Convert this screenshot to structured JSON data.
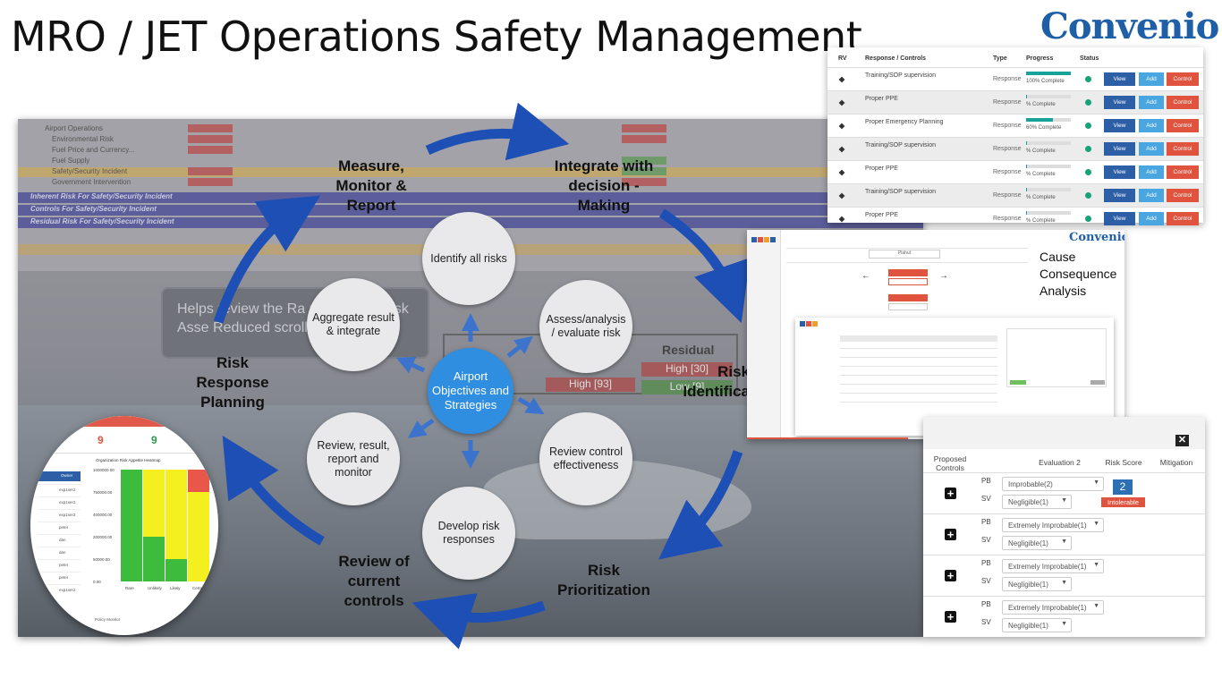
{
  "title": "MRO / JET Operations Safety Management",
  "logo": "Convenio",
  "background": {
    "rows": [
      "Airport Operations",
      "Environmental Risk",
      "Fuel Price and Currency...",
      "Fuel Supply",
      "Safety/Security Incident",
      "Government Intervention"
    ],
    "bands": [
      "Inherent Risk For Safety/Security Incident",
      "Controls For Safety/Security Incident",
      "Residual Risk For Safety/Security Incident"
    ],
    "help_text": "Helps review the Ra respond to Risk Asse Reduced scrolling.",
    "residual_label": "Residual",
    "high_a": "High [93]",
    "high_b": "High [30]",
    "low_b": "Low [9]"
  },
  "cycle": {
    "center": "Airport Objectives and Strategies",
    "circles": [
      "Identify all risks",
      "Assess/analysis / evaluate risk",
      "Review control effectiveness",
      "Develop risk responses",
      "Review, result, report and monitor",
      "Aggregate result & integrate"
    ],
    "steps": [
      "Measure, Monitor & Report",
      "Integrate with decision - Making",
      "Risk Identifica",
      "Risk Prioritization",
      "Review of current controls",
      "Risk Response Planning"
    ]
  },
  "response_table": {
    "headers": [
      "RV",
      "Response / Controls",
      "Type",
      "Progress",
      "Status"
    ],
    "rows": [
      {
        "name": "Training/SOP supervision",
        "type": "Response",
        "pct": "100% Complete",
        "fill": 1.0
      },
      {
        "name": "Proper PPE",
        "type": "Response",
        "pct": "% Complete",
        "fill": 0.02
      },
      {
        "name": "Proper Emergency Planning",
        "type": "Response",
        "pct": "60% Complete",
        "fill": 0.6
      },
      {
        "name": "Training/SOP supervision",
        "type": "Response",
        "pct": "% Complete",
        "fill": 0.02
      },
      {
        "name": "Proper PPE",
        "type": "Response",
        "pct": "% Complete",
        "fill": 0.02
      },
      {
        "name": "Training/SOP supervision",
        "type": "Response",
        "pct": "% Complete",
        "fill": 0.02
      },
      {
        "name": "Proper PPE",
        "type": "Response",
        "pct": "% Complete",
        "fill": 0.02
      }
    ],
    "btn_view": "View",
    "btn_add": "Add",
    "btn_control": "Control"
  },
  "cause_panel": {
    "logo": "Convenio",
    "caption": [
      "Cause",
      "Consequence",
      "Analysis"
    ],
    "center_label": "Plahut"
  },
  "evaluation": {
    "headers": {
      "proposed": "Proposed Controls",
      "eval": "Evaluation 2",
      "score": "Risk Score",
      "mitigation": "Mitigation"
    },
    "pb": "PB",
    "sv": "SV",
    "rows": [
      {
        "pb": "Improbable(2)",
        "sv": "Negligible(1)",
        "score": "2",
        "badge": "Intolerable"
      },
      {
        "pb": "Extremely Improbable(1)",
        "sv": "Negligible(1)"
      },
      {
        "pb": "Extremely Improbable(1)",
        "sv": "Negligible(1)"
      },
      {
        "pb": "Extremely Improbable(1)",
        "sv": "Negligible(1)"
      }
    ]
  },
  "heatmap": {
    "title": "Organization Risk Appetite Heatmap",
    "counts": [
      "9",
      "9",
      "4"
    ],
    "owner_label": "Owner",
    "yticks": [
      "1000000.00",
      "750000.00",
      "400000.00",
      "200000.00",
      "50000.00",
      "0.00"
    ],
    "xticks": [
      "Rare",
      "Unlikely",
      "Likely",
      "Certain"
    ],
    "owners": [
      "exp1ser2",
      "exp1ser2",
      "exp1ser2",
      "peter",
      "dan",
      "dan",
      "peter",
      "peter",
      "exp1ser2"
    ],
    "footer": "Policy Monitor"
  }
}
